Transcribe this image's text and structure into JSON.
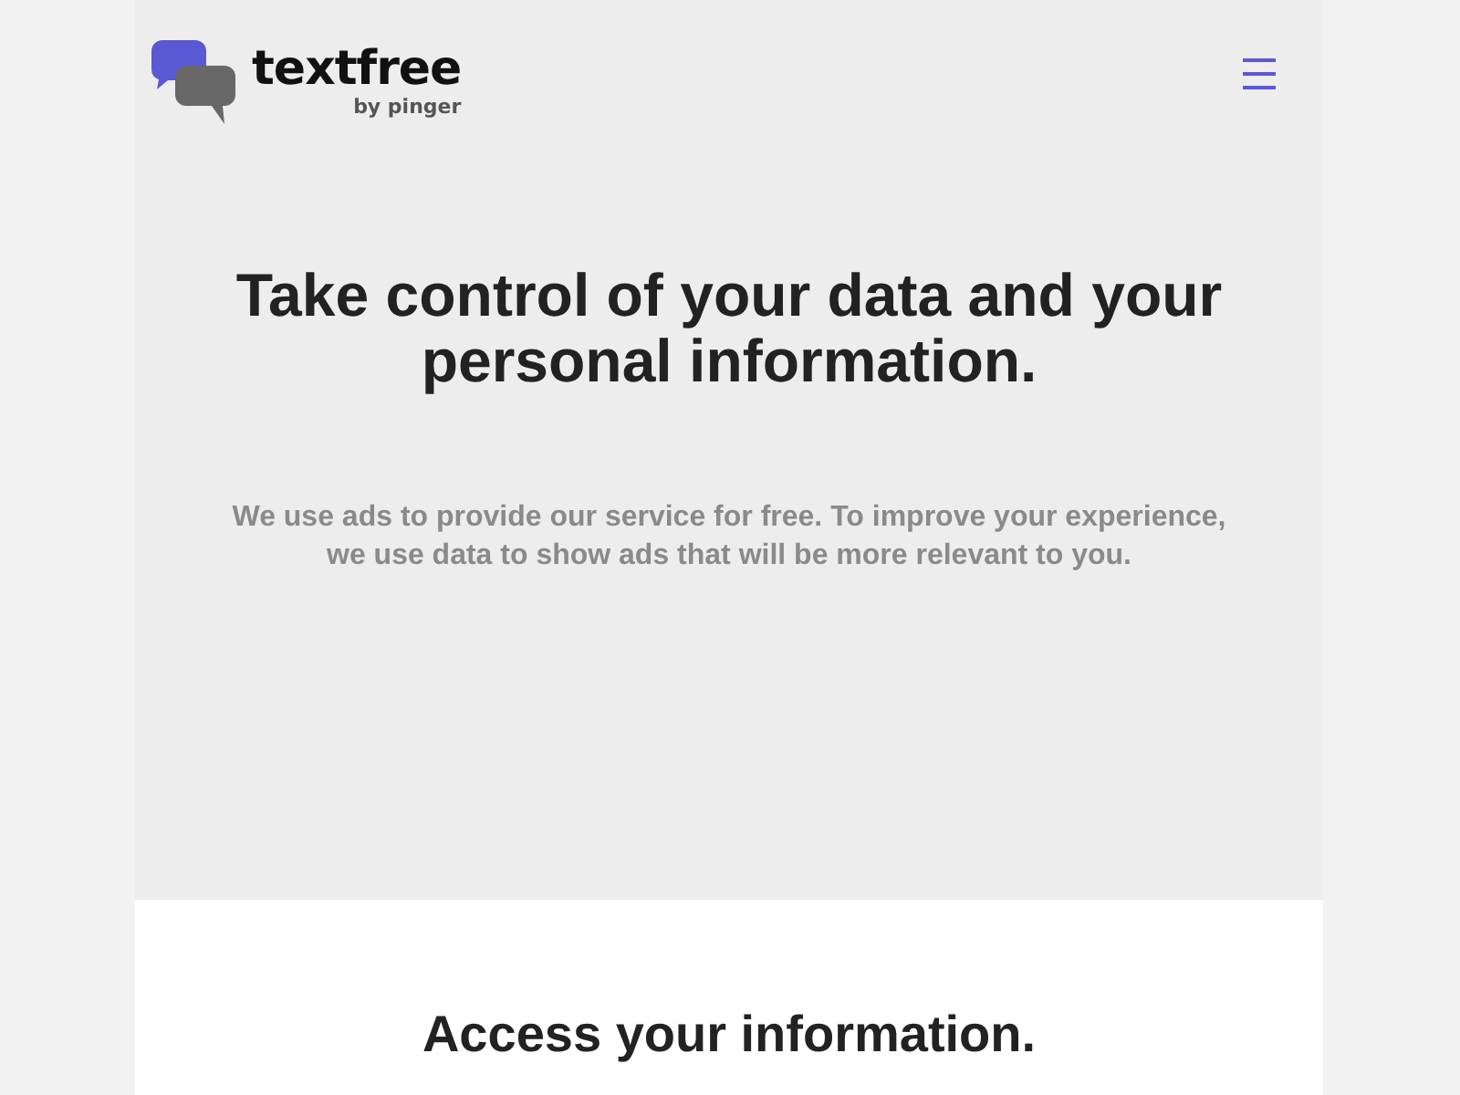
{
  "header": {
    "logo": {
      "name": "textfree",
      "tagline": "by pinger"
    }
  },
  "hero": {
    "title": "Take control of your data and your personal information.",
    "text": "We use ads to provide our service for free. To improve your experience, we use data to show ads that will be more relevant to you."
  },
  "section": {
    "title": "Access your information."
  }
}
